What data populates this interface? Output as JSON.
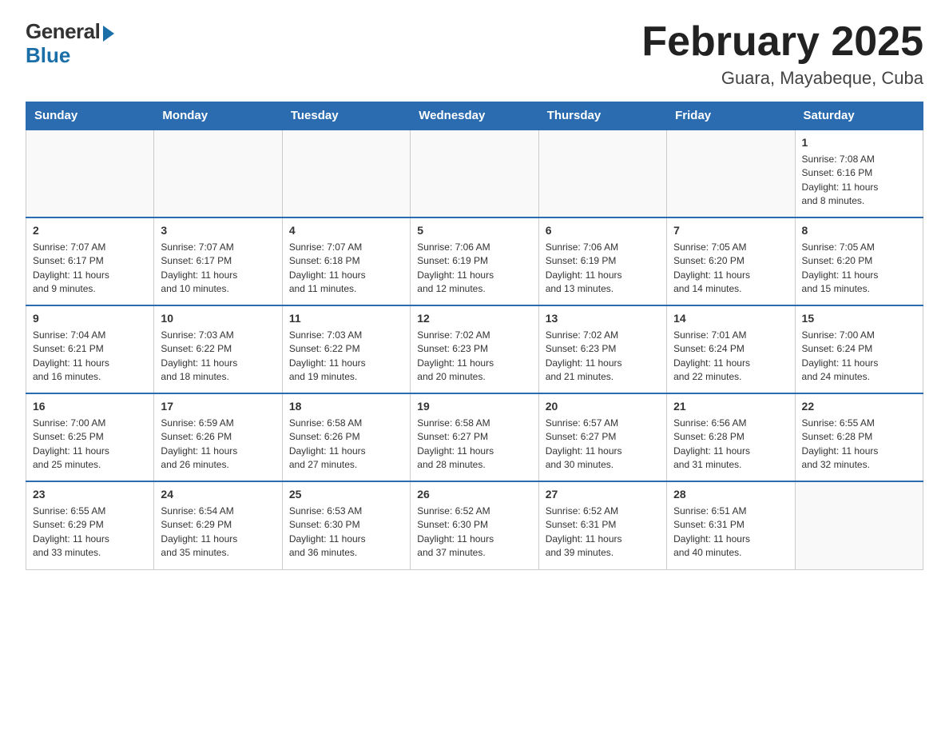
{
  "header": {
    "logo": {
      "general": "General",
      "blue": "Blue"
    },
    "title": "February 2025",
    "location": "Guara, Mayabeque, Cuba"
  },
  "days_of_week": [
    "Sunday",
    "Monday",
    "Tuesday",
    "Wednesday",
    "Thursday",
    "Friday",
    "Saturday"
  ],
  "weeks": [
    [
      {
        "day": "",
        "info": ""
      },
      {
        "day": "",
        "info": ""
      },
      {
        "day": "",
        "info": ""
      },
      {
        "day": "",
        "info": ""
      },
      {
        "day": "",
        "info": ""
      },
      {
        "day": "",
        "info": ""
      },
      {
        "day": "1",
        "info": "Sunrise: 7:08 AM\nSunset: 6:16 PM\nDaylight: 11 hours\nand 8 minutes."
      }
    ],
    [
      {
        "day": "2",
        "info": "Sunrise: 7:07 AM\nSunset: 6:17 PM\nDaylight: 11 hours\nand 9 minutes."
      },
      {
        "day": "3",
        "info": "Sunrise: 7:07 AM\nSunset: 6:17 PM\nDaylight: 11 hours\nand 10 minutes."
      },
      {
        "day": "4",
        "info": "Sunrise: 7:07 AM\nSunset: 6:18 PM\nDaylight: 11 hours\nand 11 minutes."
      },
      {
        "day": "5",
        "info": "Sunrise: 7:06 AM\nSunset: 6:19 PM\nDaylight: 11 hours\nand 12 minutes."
      },
      {
        "day": "6",
        "info": "Sunrise: 7:06 AM\nSunset: 6:19 PM\nDaylight: 11 hours\nand 13 minutes."
      },
      {
        "day": "7",
        "info": "Sunrise: 7:05 AM\nSunset: 6:20 PM\nDaylight: 11 hours\nand 14 minutes."
      },
      {
        "day": "8",
        "info": "Sunrise: 7:05 AM\nSunset: 6:20 PM\nDaylight: 11 hours\nand 15 minutes."
      }
    ],
    [
      {
        "day": "9",
        "info": "Sunrise: 7:04 AM\nSunset: 6:21 PM\nDaylight: 11 hours\nand 16 minutes."
      },
      {
        "day": "10",
        "info": "Sunrise: 7:03 AM\nSunset: 6:22 PM\nDaylight: 11 hours\nand 18 minutes."
      },
      {
        "day": "11",
        "info": "Sunrise: 7:03 AM\nSunset: 6:22 PM\nDaylight: 11 hours\nand 19 minutes."
      },
      {
        "day": "12",
        "info": "Sunrise: 7:02 AM\nSunset: 6:23 PM\nDaylight: 11 hours\nand 20 minutes."
      },
      {
        "day": "13",
        "info": "Sunrise: 7:02 AM\nSunset: 6:23 PM\nDaylight: 11 hours\nand 21 minutes."
      },
      {
        "day": "14",
        "info": "Sunrise: 7:01 AM\nSunset: 6:24 PM\nDaylight: 11 hours\nand 22 minutes."
      },
      {
        "day": "15",
        "info": "Sunrise: 7:00 AM\nSunset: 6:24 PM\nDaylight: 11 hours\nand 24 minutes."
      }
    ],
    [
      {
        "day": "16",
        "info": "Sunrise: 7:00 AM\nSunset: 6:25 PM\nDaylight: 11 hours\nand 25 minutes."
      },
      {
        "day": "17",
        "info": "Sunrise: 6:59 AM\nSunset: 6:26 PM\nDaylight: 11 hours\nand 26 minutes."
      },
      {
        "day": "18",
        "info": "Sunrise: 6:58 AM\nSunset: 6:26 PM\nDaylight: 11 hours\nand 27 minutes."
      },
      {
        "day": "19",
        "info": "Sunrise: 6:58 AM\nSunset: 6:27 PM\nDaylight: 11 hours\nand 28 minutes."
      },
      {
        "day": "20",
        "info": "Sunrise: 6:57 AM\nSunset: 6:27 PM\nDaylight: 11 hours\nand 30 minutes."
      },
      {
        "day": "21",
        "info": "Sunrise: 6:56 AM\nSunset: 6:28 PM\nDaylight: 11 hours\nand 31 minutes."
      },
      {
        "day": "22",
        "info": "Sunrise: 6:55 AM\nSunset: 6:28 PM\nDaylight: 11 hours\nand 32 minutes."
      }
    ],
    [
      {
        "day": "23",
        "info": "Sunrise: 6:55 AM\nSunset: 6:29 PM\nDaylight: 11 hours\nand 33 minutes."
      },
      {
        "day": "24",
        "info": "Sunrise: 6:54 AM\nSunset: 6:29 PM\nDaylight: 11 hours\nand 35 minutes."
      },
      {
        "day": "25",
        "info": "Sunrise: 6:53 AM\nSunset: 6:30 PM\nDaylight: 11 hours\nand 36 minutes."
      },
      {
        "day": "26",
        "info": "Sunrise: 6:52 AM\nSunset: 6:30 PM\nDaylight: 11 hours\nand 37 minutes."
      },
      {
        "day": "27",
        "info": "Sunrise: 6:52 AM\nSunset: 6:31 PM\nDaylight: 11 hours\nand 39 minutes."
      },
      {
        "day": "28",
        "info": "Sunrise: 6:51 AM\nSunset: 6:31 PM\nDaylight: 11 hours\nand 40 minutes."
      },
      {
        "day": "",
        "info": ""
      }
    ]
  ]
}
